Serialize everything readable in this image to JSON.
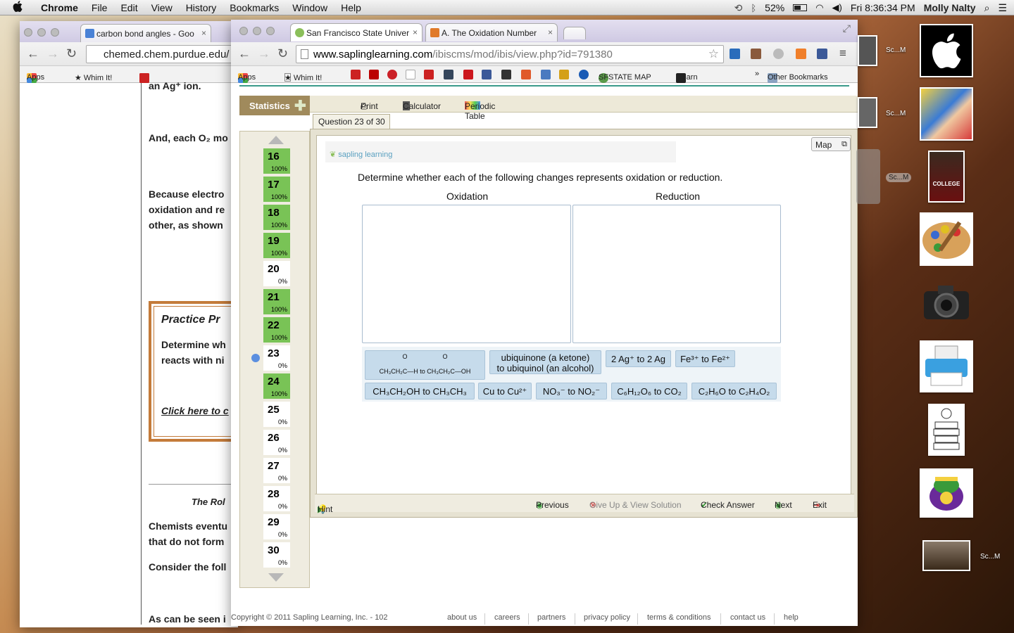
{
  "menubar": {
    "apple": "",
    "app": "Chrome",
    "items": [
      "File",
      "Edit",
      "View",
      "History",
      "Bookmarks",
      "Window",
      "Help"
    ],
    "battery": "52%",
    "clock": "Fri 8:36:34 PM",
    "user": "Molly Nalty"
  },
  "back_window": {
    "tab_title": "carbon bond angles - Goo",
    "url": "chemed.chem.purdue.edu/",
    "bookmarks": {
      "apps": "Apps",
      "whim": "★ Whim It!"
    },
    "content": {
      "line0": "an Ag⁺ ion.",
      "line1": "And, each O₂ mo",
      "line2": "Because electro",
      "line3": "oxidation and re",
      "line4": "other, as shown",
      "practice_title": "Practice Pr",
      "practice_l1": "Determine wh",
      "practice_l2": "reacts with ni",
      "practice_link": "Click here to c",
      "role_title": "The Rol",
      "line5": "Chemists eventu",
      "line6": "that do not form",
      "line7": "Consider the foll",
      "line8": "As can be seen i"
    }
  },
  "front_window": {
    "tabs": [
      {
        "title": "San Francisco State Univer",
        "close": "×"
      },
      {
        "title": "A. The Oxidation Number",
        "close": "×"
      }
    ],
    "url_host": "www.saplinglearning.com",
    "url_path": "/ibiscms/mod/ibis/view.php?id=791380",
    "bookmarks": {
      "apps": "Apps",
      "whim": "★ Whim It!",
      "sfstate": "SFSTATE MAP",
      "ilearn": "iLearn",
      "more": "»",
      "other": "Other Bookmarks"
    }
  },
  "sapling": {
    "statistics": "Statistics",
    "tools": {
      "print": "Print",
      "calculator": "Calculator",
      "periodic": "Periodic Table"
    },
    "question_tab": "Question 23 of 30",
    "map": "Map",
    "logo": "sapling learning",
    "prompt": "Determine whether each of the following changes represents oxidation or reduction.",
    "col_oxidation": "Oxidation",
    "col_reduction": "Reduction",
    "questions": [
      {
        "n": "16",
        "pct": "100%",
        "done": true
      },
      {
        "n": "17",
        "pct": "100%",
        "done": true
      },
      {
        "n": "18",
        "pct": "100%",
        "done": true
      },
      {
        "n": "19",
        "pct": "100%",
        "done": true
      },
      {
        "n": "20",
        "pct": "0%",
        "done": false
      },
      {
        "n": "21",
        "pct": "100%",
        "done": true
      },
      {
        "n": "22",
        "pct": "100%",
        "done": true
      },
      {
        "n": "23",
        "pct": "0%",
        "done": false
      },
      {
        "n": "24",
        "pct": "100%",
        "done": true
      },
      {
        "n": "25",
        "pct": "0%",
        "done": false
      },
      {
        "n": "26",
        "pct": "0%",
        "done": false
      },
      {
        "n": "27",
        "pct": "0%",
        "done": false
      },
      {
        "n": "28",
        "pct": "0%",
        "done": false
      },
      {
        "n": "29",
        "pct": "0%",
        "done": false
      },
      {
        "n": "30",
        "pct": "0%",
        "done": false
      }
    ],
    "tiles": {
      "t1_top": "O                    O",
      "t1_bottom": "CH₃CH₂C—H  to  CH₃CH₂C—OH",
      "t2_l1": "ubiquinone (a ketone)",
      "t2_l2": "to ubiquinol (an alcohol)",
      "t3": "2 Ag⁺ to 2 Ag",
      "t4": "Fe³⁺ to Fe²⁺",
      "t5": "CH₃CH₂OH to CH₃CH₃",
      "t6": "Cu to Cu²⁺",
      "t7": "NO₃⁻  to NO₂⁻",
      "t8": "C₆H₁₂O₆ to CO₂",
      "t9": "C₂H₆O to C₂H₄O₂"
    },
    "hint": "Hint",
    "previous": "Previous",
    "giveup": "Give Up & View Solution",
    "check": "Check Answer",
    "next": "Next",
    "exit": "Exit",
    "copyright": "Copyright © 2011 Sapling Learning, Inc. - 102",
    "footer_links": [
      "about us",
      "careers",
      "partners",
      "privacy policy",
      "terms & conditions",
      "contact us",
      "help"
    ]
  },
  "desktop": {
    "labels": [
      "Sc...M",
      "Sc...M",
      "Sc...M",
      "Sc...M"
    ]
  }
}
